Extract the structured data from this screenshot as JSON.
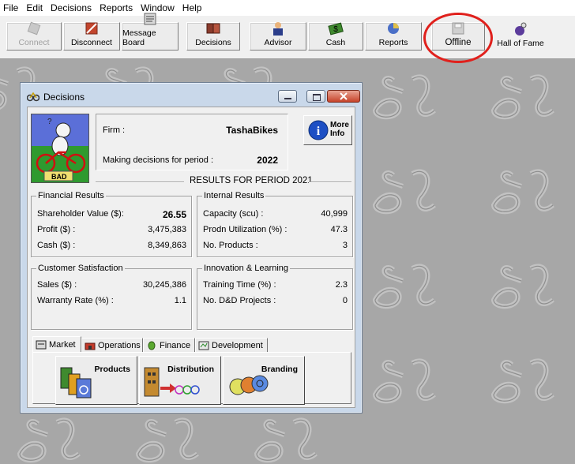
{
  "menu": [
    "File",
    "Edit",
    "Decisions",
    "Reports",
    "Window",
    "Help"
  ],
  "toolbar": {
    "connect": "Connect",
    "disconnect": "Disconnect",
    "message_board": "Message Board",
    "decisions": "Decisions",
    "advisor": "Advisor",
    "cash": "Cash",
    "reports": "Reports",
    "offline": "Offline",
    "hall_of_fame": "Hall of Fame"
  },
  "window": {
    "title": "Decisions",
    "badge": "BAD",
    "firm_label": "Firm :",
    "firm_value": "TashaBikes",
    "period_label": "Making decisions for period :",
    "period_value": "2022",
    "more_info": "More Info",
    "results_title": "RESULTS FOR PERIOD 2021"
  },
  "financial": {
    "title": "Financial Results",
    "rows": [
      {
        "label": "Shareholder Value ($):",
        "value": "26.55"
      },
      {
        "label": "Profit ($) :",
        "value": "3,475,383"
      },
      {
        "label": "Cash ($) :",
        "value": "8,349,863"
      }
    ]
  },
  "internal": {
    "title": "Internal Results",
    "rows": [
      {
        "label": "Capacity (scu) :",
        "value": "40,999"
      },
      {
        "label": "Prodn Utilization (%) :",
        "value": "47.3"
      },
      {
        "label": "No. Products :",
        "value": "3"
      }
    ]
  },
  "customer": {
    "title": "Customer Satisfaction",
    "rows": [
      {
        "label": "Sales ($) :",
        "value": "30,245,386"
      },
      {
        "label": "Warranty Rate (%) :",
        "value": "1.1"
      }
    ]
  },
  "innovation": {
    "title": "Innovation & Learning",
    "rows": [
      {
        "label": "Training Time (%) :",
        "value": "2.3"
      },
      {
        "label": "No. D&D Projects :",
        "value": "0"
      }
    ]
  },
  "tabs": [
    "Market",
    "Operations",
    "Finance",
    "Development"
  ],
  "market_buttons": [
    "Products",
    "Distribution",
    "Branding"
  ],
  "colors": {
    "highlight_circle": "#e0201c",
    "background": "#a7a7a7"
  }
}
